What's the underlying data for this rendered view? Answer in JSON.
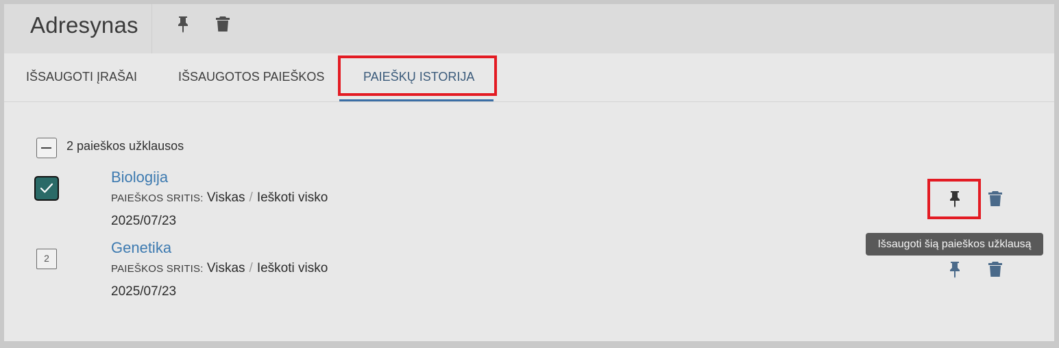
{
  "header": {
    "title": "Adresynas"
  },
  "tabs": [
    {
      "label": "IŠSAUGOTI ĮRAŠAI",
      "active": false
    },
    {
      "label": "IŠSAUGOTOS PAIEŠKOS",
      "active": false
    },
    {
      "label": "PAIEŠKŲ ISTORIJA",
      "active": true
    }
  ],
  "group": {
    "label": "2 paieškos užklausos"
  },
  "entries": [
    {
      "index": "1",
      "checked": true,
      "title": "Biologija",
      "scope_label": "PAIEŠKOS SRITIS:",
      "scope_value": "Viskas",
      "scope_sep": "/",
      "scope_mode": "Ieškoti visko",
      "date": "2025/07/23"
    },
    {
      "index": "2",
      "checked": false,
      "title": "Genetika",
      "scope_label": "PAIEŠKOS SRITIS:",
      "scope_value": "Viskas",
      "scope_sep": "/",
      "scope_mode": "Ieškoti visko",
      "date": "2025/07/23"
    }
  ],
  "tooltip": {
    "text": "Išsaugoti šią paieškos užklausą"
  },
  "colors": {
    "accent": "#3b6ea5",
    "link": "#3d7ab0",
    "checked": "#2a6a67",
    "icon": "#4a6a8a",
    "highlight": "#e31b23"
  },
  "icons": {
    "header_pin": "pin-icon",
    "header_delete": "trash-icon",
    "row_pin": "pin-icon",
    "row_delete": "trash-icon",
    "check": "checkmark-icon",
    "collapse": "minus-icon"
  }
}
